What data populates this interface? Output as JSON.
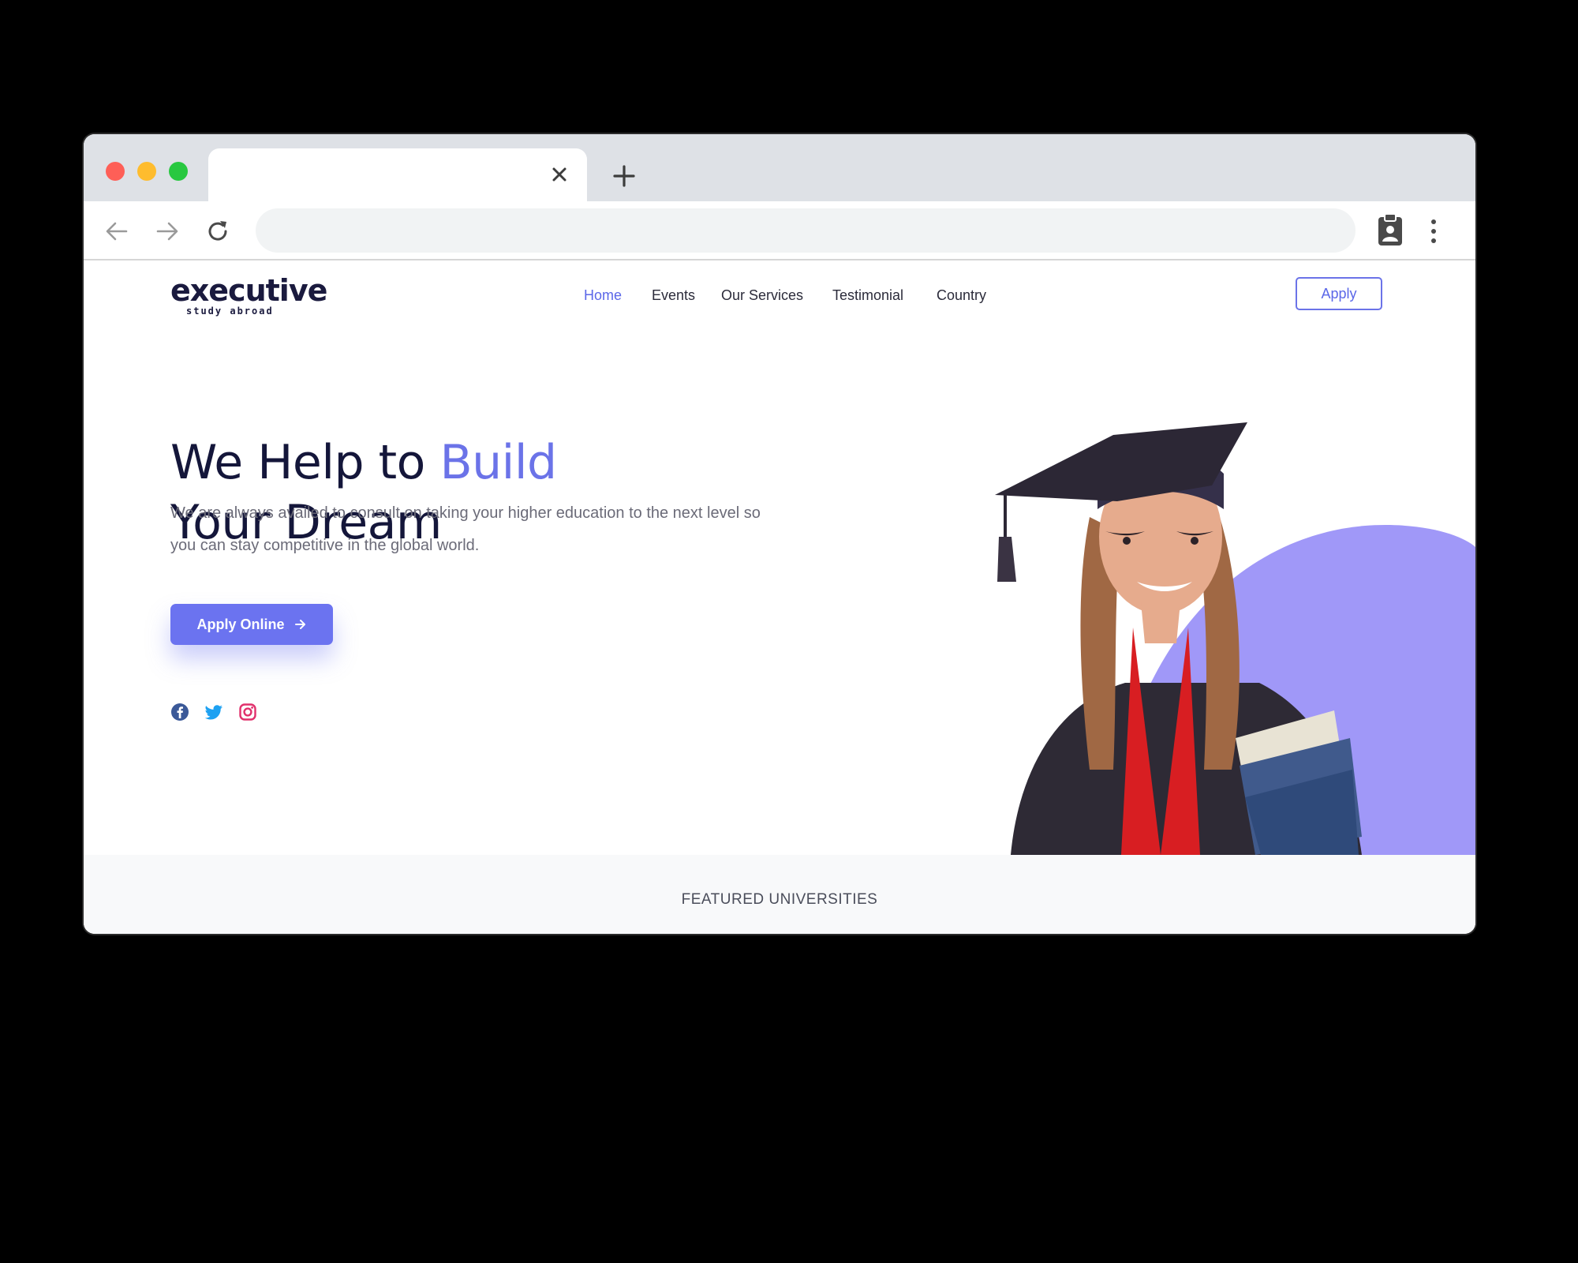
{
  "browser": {
    "tab_title": "",
    "address": ""
  },
  "site": {
    "logo_main": "executive",
    "logo_sub": "study abroad",
    "nav": [
      "Home",
      "Events",
      "Our Services",
      "Testimonial",
      "Country"
    ],
    "nav_active": "Home",
    "apply_label": "Apply"
  },
  "hero": {
    "title_part1": "We Help to ",
    "title_accent": "Build",
    "title_line2": "Your Dream",
    "description": "We are always availed to consult on taking your higher education to the next level so you can stay competitive in the global world.",
    "cta_label": "Apply Online"
  },
  "social": [
    "facebook-icon",
    "twitter-icon",
    "instagram-icon"
  ],
  "featured": {
    "title": "FEATURED UNIVERSITIES"
  },
  "colors": {
    "accent": "#6b73e8",
    "heading": "#14163a",
    "blob": "#a098f8"
  }
}
